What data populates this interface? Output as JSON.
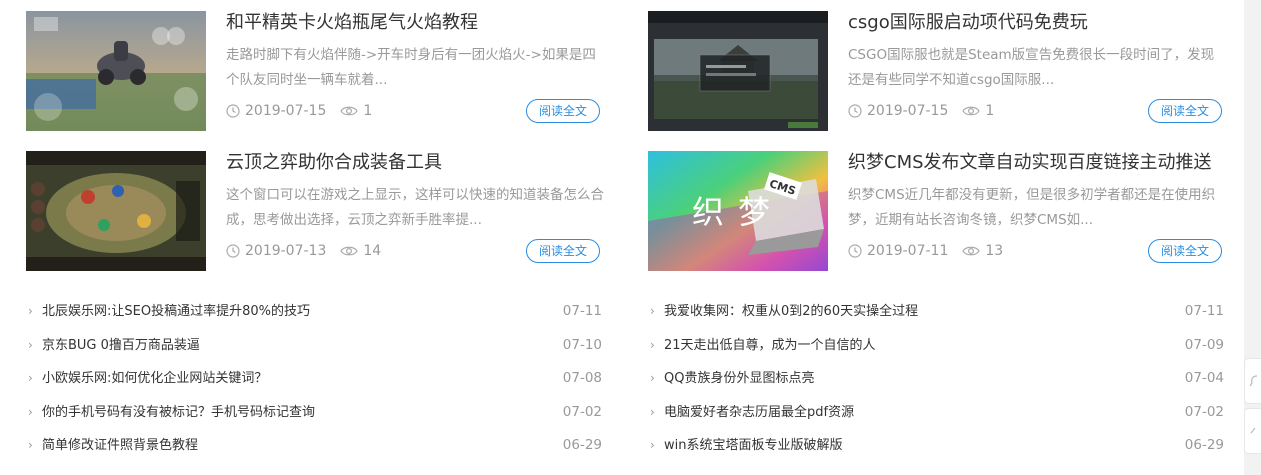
{
  "cards": [
    {
      "title": "和平精英卡火焰瓶尾气火焰教程",
      "desc": "走路时脚下有火焰伴随->开车时身后有一团火焰火->如果是四个队友同时坐一辆车就着...",
      "date": "2019-07-15",
      "views": "1",
      "read_label": "阅读全文",
      "thumb_icon": "game-screenshot-thumbnail"
    },
    {
      "title": "csgo国际服启动项代码免费玩",
      "desc": "CSGO国际服也就是Steam版宣告免费很长一段时间了，发现还是有些同学不知道csgo国际服...",
      "date": "2019-07-15",
      "views": "1",
      "read_label": "阅读全文",
      "thumb_icon": "csgo-screenshot-thumbnail"
    },
    {
      "title": "云顶之弈助你合成装备工具",
      "desc": "这个窗口可以在游戏之上显示，这样可以快速的知道装备怎么合成，思考做出选择，云顶之弈新手胜率提...",
      "date": "2019-07-13",
      "views": "14",
      "read_label": "阅读全文",
      "thumb_icon": "tft-screenshot-thumbnail"
    },
    {
      "title": "织梦CMS发布文章自动实现百度链接主动推送",
      "desc": "织梦CMS近几年都没有更新，但是很多初学者都还是在使用织梦，近期有站长咨询冬镜，织梦CMS如...",
      "date": "2019-07-11",
      "views": "13",
      "read_label": "阅读全文",
      "thumb_icon": "dedecms-banner-thumbnail",
      "thumb_text_1": "织",
      "thumb_text_2": "梦",
      "thumb_badge": "CMS"
    }
  ],
  "list_left": [
    {
      "title": "北辰娱乐网:让SEO投稿通过率提升80%的技巧",
      "date": "07-11"
    },
    {
      "title": "京东BUG 0撸百万商品装逼",
      "date": "07-10"
    },
    {
      "title": "小欧娱乐网:如何优化企业网站关键词？",
      "date": "07-08"
    },
    {
      "title": "你的手机号码有没有被标记？手机号码标记查询",
      "date": "07-02"
    },
    {
      "title": "简单修改证件照背景色教程",
      "date": "06-29"
    }
  ],
  "list_right": [
    {
      "title": "我爱收集网：权重从0到2的60天实操全过程",
      "date": "07-11"
    },
    {
      "title": "21天走出低自尊，成为一个自信的人",
      "date": "07-09"
    },
    {
      "title": "QQ贵族身份外显图标点亮",
      "date": "07-04"
    },
    {
      "title": "电脑爱好者杂志历届最全pdf资源",
      "date": "07-02"
    },
    {
      "title": "win系统宝塔面板专业版破解版",
      "date": "06-29"
    }
  ],
  "side_tabs": [
    "chat-icon",
    "back-to-top-icon"
  ],
  "colors": {
    "accent": "#2a8de0",
    "muted": "#999999",
    "text": "#333333"
  }
}
